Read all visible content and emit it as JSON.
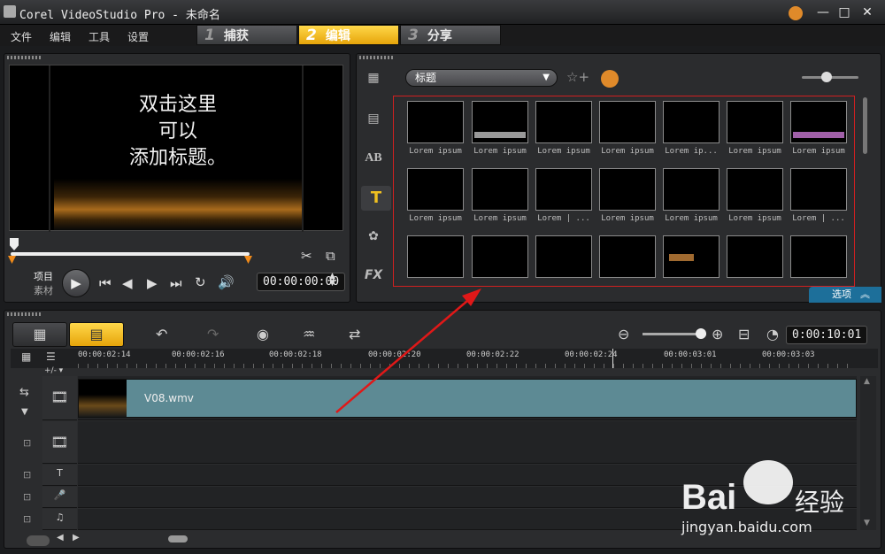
{
  "window": {
    "title": "Corel VideoStudio Pro - 未命名",
    "min": "—",
    "restore": "□",
    "close": "✕"
  },
  "menu": [
    "文件",
    "编辑",
    "工具",
    "设置"
  ],
  "steps": [
    {
      "num": "1",
      "label": "捕获",
      "active": false
    },
    {
      "num": "2",
      "label": "编辑",
      "active": true
    },
    {
      "num": "3",
      "label": "分享",
      "active": false
    }
  ],
  "preview": {
    "overlay_lines": [
      "双击这里",
      "可以",
      "添加标题。"
    ],
    "mode_project": "项目",
    "mode_clip": "素材",
    "timecode": "00:00:00:00"
  },
  "library": {
    "category": "标题",
    "options_label": "选项",
    "categories": [
      "media-icon",
      "transition-icon",
      "ab-icon",
      "title-icon",
      "graphic-icon",
      "fx-icon"
    ],
    "row1": [
      "Lorem ipsum",
      "Lorem ipsum",
      "Lorem ipsum",
      "Lorem ipsum",
      "Lorem ip...",
      "Lorem ipsum",
      "Lorem ipsum"
    ],
    "row2": [
      "Lorem ipsum",
      "Lorem ipsum",
      "Lorem | ...",
      "Lorem ipsum",
      "Lorem ipsum",
      "Lorem ipsum",
      "Lorem | ..."
    ],
    "row3": [
      "",
      "",
      "",
      "",
      "",
      "",
      ""
    ]
  },
  "timeline": {
    "ticks": [
      "00:00:02:14",
      "00:00:02:16",
      "00:00:02:18",
      "00:00:02:20",
      "00:00:02:22",
      "00:00:02:24",
      "00:00:03:01",
      "00:00:03:03"
    ],
    "clip_name": "V08.wmv",
    "duration": "0:00:10:01",
    "add_remove": "+/- ▾"
  },
  "watermark": {
    "brand": "Bai",
    "brand2": "经验",
    "url": "jingyan.baidu.com"
  }
}
